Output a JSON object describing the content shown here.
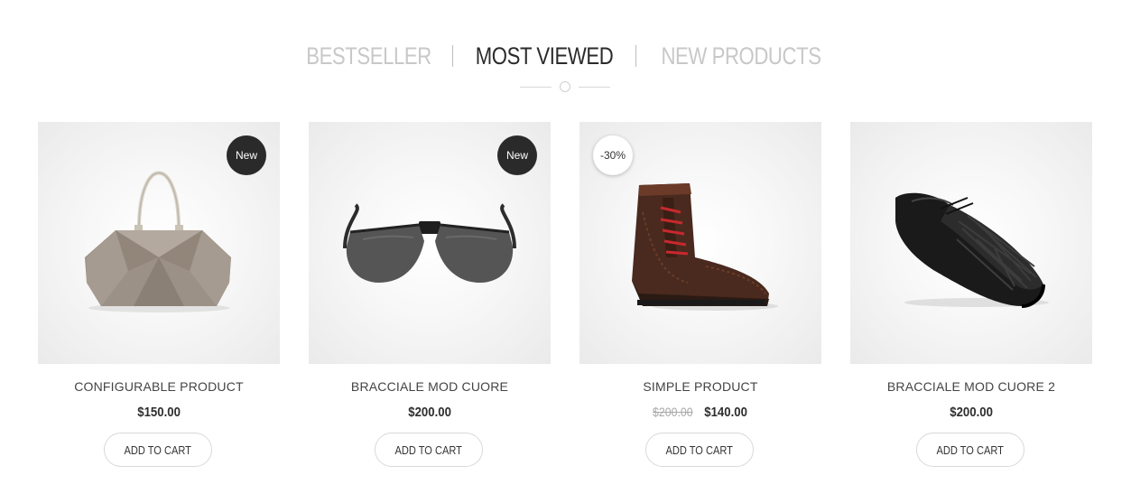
{
  "tabs": [
    {
      "label": "BESTSELLER",
      "active": false
    },
    {
      "label": "MOST VIEWED",
      "active": true
    },
    {
      "label": "NEW PRODUCTS",
      "active": false
    }
  ],
  "products": [
    {
      "name": "CONFIGURABLE PRODUCT",
      "price": "$150.00",
      "old_price": "",
      "badge": "New",
      "badge_type": "new",
      "image_icon": "handbag-icon",
      "button": "ADD TO CART"
    },
    {
      "name": "BRACCIALE MOD CUORE",
      "price": "$200.00",
      "old_price": "",
      "badge": "New",
      "badge_type": "new",
      "image_icon": "sunglasses-icon",
      "button": "ADD TO CART"
    },
    {
      "name": "SIMPLE PRODUCT",
      "price": "$140.00",
      "old_price": "$200.00",
      "badge": "-30%",
      "badge_type": "sale",
      "image_icon": "boot-icon",
      "button": "ADD TO CART"
    },
    {
      "name": "BRACCIALE MOD CUORE 2",
      "price": "$200.00",
      "old_price": "",
      "badge": "",
      "badge_type": "",
      "image_icon": "shoe-icon",
      "button": "ADD TO CART"
    }
  ],
  "colors": {
    "active_tab": "#2b2b2b",
    "inactive_tab": "#c8c8c8",
    "new_badge": "#2a2a2a",
    "old_price": "#a8a8a8"
  }
}
